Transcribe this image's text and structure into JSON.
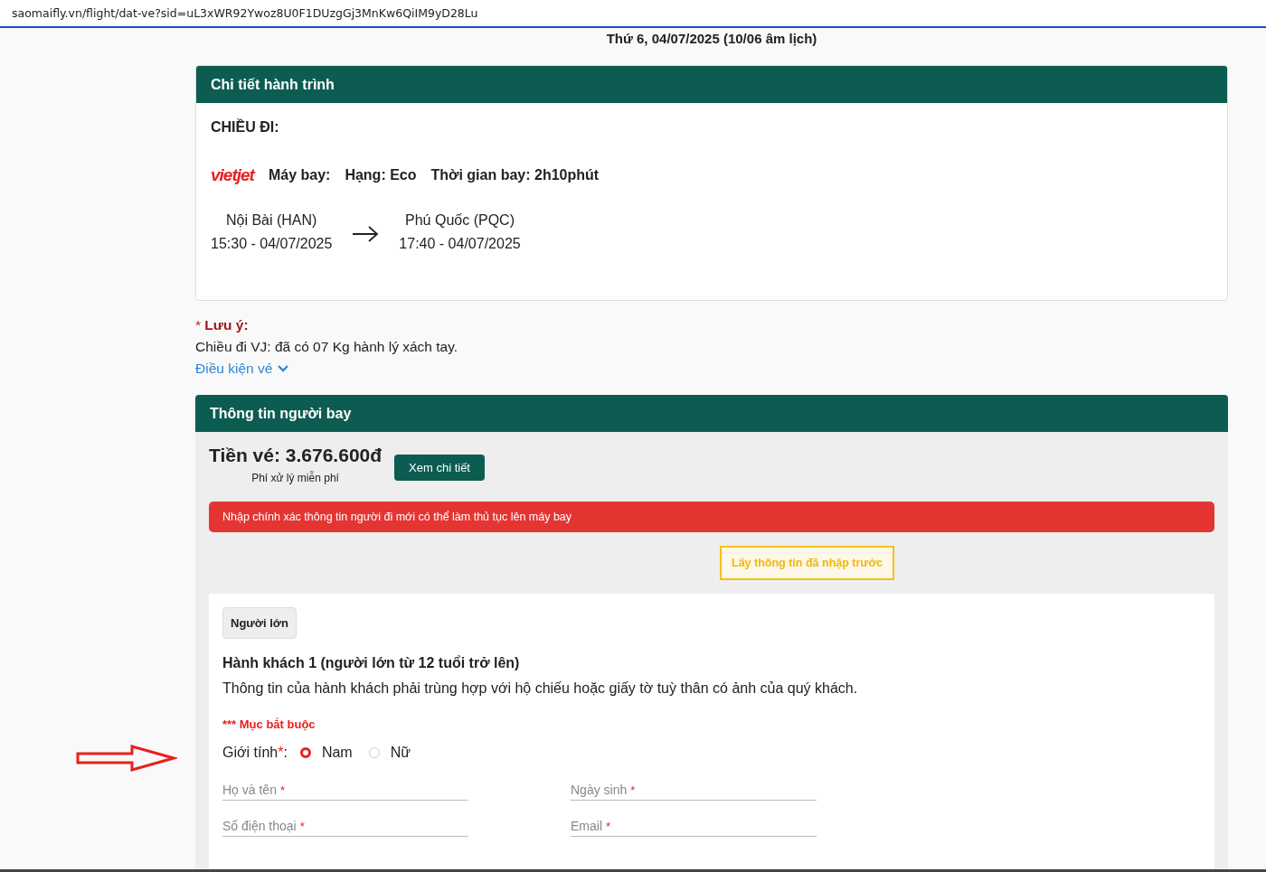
{
  "address_bar": {
    "url": "saomaifly.vn/flight/dat-ve?sid=uL3xWR92Ywoz8U0F1DUzgGj3MnKw6QiIM9yD28Lu"
  },
  "date_title": "Thứ 6, 04/07/2025 (10/06 âm lịch)",
  "itinerary": {
    "title": "Chi tiết hành trình",
    "direction": "CHIỀU ĐI:",
    "airline_logo": "vietjet",
    "aircraft": "Máy bay:",
    "class": "Hạng: Eco",
    "duration": "Thời gian bay: 2h10phút",
    "departure": {
      "airport": "Nội Bài (HAN)",
      "time": "15:30 - 04/07/2025"
    },
    "arrival": {
      "airport": "Phú Quốc (PQC)",
      "time": "17:40 - 04/07/2025"
    }
  },
  "note": {
    "title": "* **Lưu ý:**",
    "text": "Chiều đi VJ: đã có 07 Kg hành lý xách tay.",
    "link": "Điều kiện vé",
    "expanded": false
  },
  "passenger_info": {
    "title": "Thông tin người bay",
    "price": "Tiền vé: 3.676.600đ",
    "fee_note": "Phí xử lý miễn phí",
    "details_button": "Xem chi tiết",
    "alert": "Nhập chính xác thông tin người đi mới có thể làm thủ tục lên máy bay",
    "prefill_button": "Lấy thông tin đã nhập trước",
    "tabs": [
      {
        "label": "Người lớn",
        "selected": true
      }
    ],
    "passenger_title": "Hành khách 1 (người lớn từ 12 tuổi trở lên)",
    "passenger_hint": "Thông tin của hành khách phải trùng hợp với hộ chiếu hoặc giấy tờ tuỳ thân có ảnh của quý khách.",
    "required_note": "*** Mục bắt buộc",
    "gender": {
      "label": "Giới tính",
      "required_mark": "*",
      "suffix": ":",
      "options": [
        {
          "label": "Nam",
          "selected": true
        },
        {
          "label": "Nữ",
          "selected": false
        }
      ]
    },
    "fields": [
      {
        "placeholder": "Họ và tên",
        "required_mark": "*"
      },
      {
        "placeholder": "Ngày sinh",
        "required_mark": "*"
      },
      {
        "placeholder": "Số điện thoại",
        "required_mark": "*"
      },
      {
        "placeholder": "Email",
        "required_mark": "*"
      }
    ]
  }
}
